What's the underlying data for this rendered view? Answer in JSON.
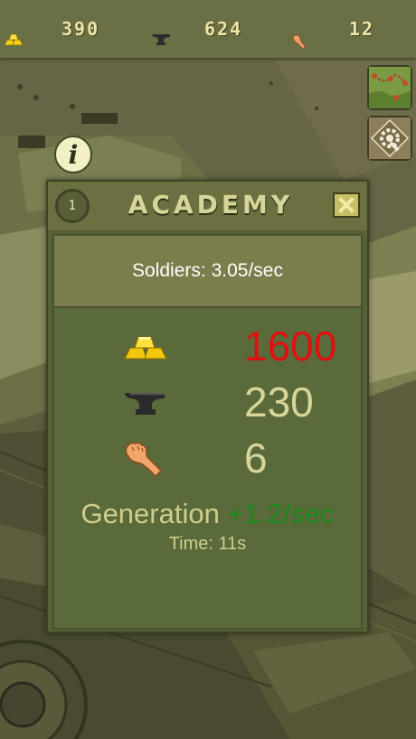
{
  "resources": {
    "gold": {
      "icon": "gold-bars-icon",
      "value": "390"
    },
    "iron": {
      "icon": "anvil-icon",
      "value": "624"
    },
    "manpower": {
      "icon": "fist-icon",
      "value": "12"
    }
  },
  "side_buttons": [
    {
      "icon": "map-icon"
    },
    {
      "icon": "settings-gear-icon"
    }
  ],
  "info_button": {
    "icon": "info-icon",
    "glyph": "i"
  },
  "dialog": {
    "level": "1",
    "title": "ACADEMY",
    "close_icon": "close-x-icon",
    "production_rate": "Soldiers: 3.05/sec",
    "costs": [
      {
        "icon": "gold-bars-icon",
        "value": "1600",
        "color": "#e01010"
      },
      {
        "icon": "anvil-icon",
        "value": "230",
        "color": "#d8d69a"
      },
      {
        "icon": "fist-icon",
        "value": "6",
        "color": "#d8d69a"
      }
    ],
    "generation_label": "Generation",
    "generation_rate": "+1.2/sec",
    "time_text": "Time: 11s"
  },
  "colors": {
    "bar_bg": "#6b6f46",
    "dialog_bg": "#566138",
    "insufficient": "#e01010",
    "gain": "#1d8a1d"
  }
}
